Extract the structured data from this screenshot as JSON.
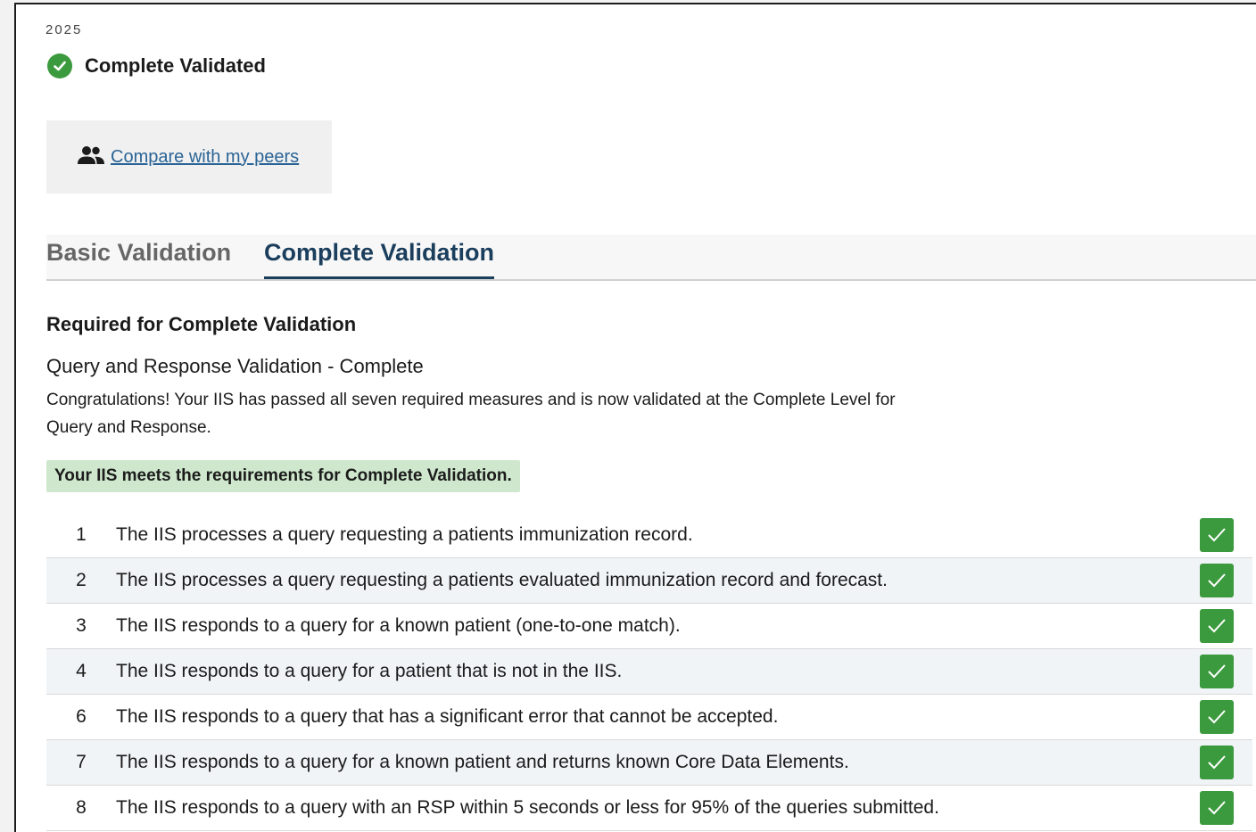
{
  "header": {
    "year": "2025",
    "status_label": "Complete Validated"
  },
  "peers": {
    "link_label": "Compare with my peers"
  },
  "tabs": [
    {
      "label": "Basic Validation",
      "active": false
    },
    {
      "label": "Complete Validation",
      "active": true
    }
  ],
  "section": {
    "title": "Required for Complete Validation",
    "subtitle": "Query and Response Validation - Complete",
    "description": "Congratulations! Your IIS has passed all seven required measures and is now validated at the Complete Level for Query and Response.",
    "status_banner": "Your IIS meets the requirements for Complete Validation."
  },
  "measures": [
    {
      "number": "1",
      "text": "The IIS processes a query requesting a patients immunization record."
    },
    {
      "number": "2",
      "text": "The IIS processes a query requesting a patients evaluated immunization record and forecast."
    },
    {
      "number": "3",
      "text": "The IIS responds to a query for a known patient (one-to-one match)."
    },
    {
      "number": "4",
      "text": "The IIS responds to a query for a patient that is not in the IIS."
    },
    {
      "number": "6",
      "text": "The IIS responds to a query that has a significant error that cannot be accepted."
    },
    {
      "number": "7",
      "text": "The IIS responds to a query for a known patient and returns known Core Data Elements."
    },
    {
      "number": "8",
      "text": "The IIS responds to a query with an RSP within 5 seconds or less for 95% of the queries submitted."
    }
  ],
  "colors": {
    "success": "#3c9a3e",
    "banner": "#cfe8cd",
    "link": "#2a6496",
    "tab_active": "#1a3e5c"
  }
}
